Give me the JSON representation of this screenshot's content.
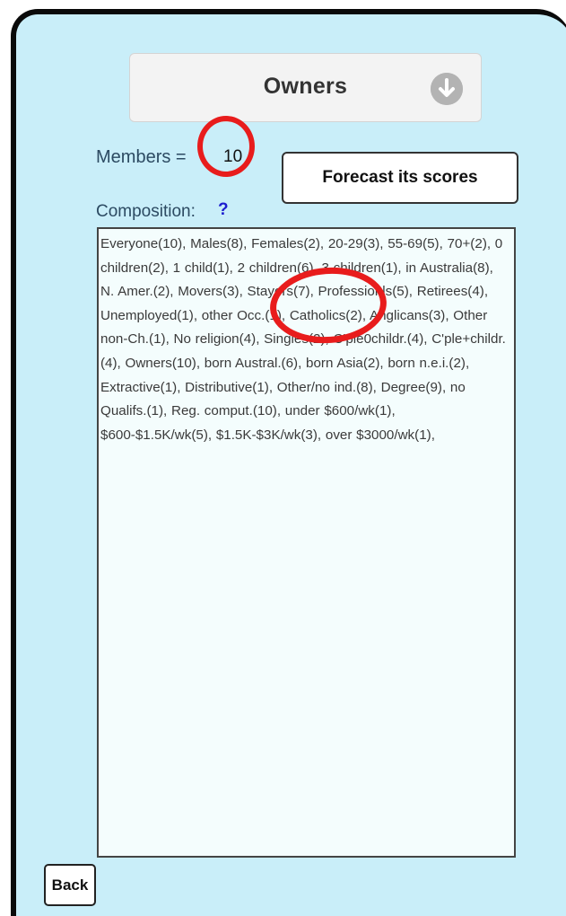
{
  "header": {
    "title": "Owners",
    "dropdown_icon": "arrow-down-circle-icon"
  },
  "members": {
    "label": "Members =",
    "value": "10"
  },
  "forecast_button": {
    "label": "Forecast its scores"
  },
  "composition": {
    "label": "Composition:",
    "help": "?",
    "text": "Everyone(10), Males(8), Females(2), 20-29(3), 55-69(5), 70+(2), 0 children(2), 1 child(1), 2 children(6), 3 children(1), in Australia(8), N. Amer.(2), Movers(3), Stayers(7), Professionls(5), Retirees(4), Unemployed(1), other Occ.(1), Catholics(2), Anglicans(3), Other non-Ch.(1), No religion(4), Singles(2), C'ple0childr.(4), C'ple+childr.(4), Owners(10), born Austral.(6), born Asia(2), born n.e.i.(2), Extractive(1), Distributive(1), Other/no ind.(8), Degree(9), no Qualifs.(1), Reg. comput.(10), under $600/wk(1), $600-$1.5K/wk(5), $1.5K-$3K/wk(3), over $3000/wk(1),"
  },
  "back_button": {
    "label": "Back"
  },
  "colors": {
    "background": "#c9eef9",
    "highlight_ring": "#e81c1c",
    "help": "#1d1dcf"
  }
}
